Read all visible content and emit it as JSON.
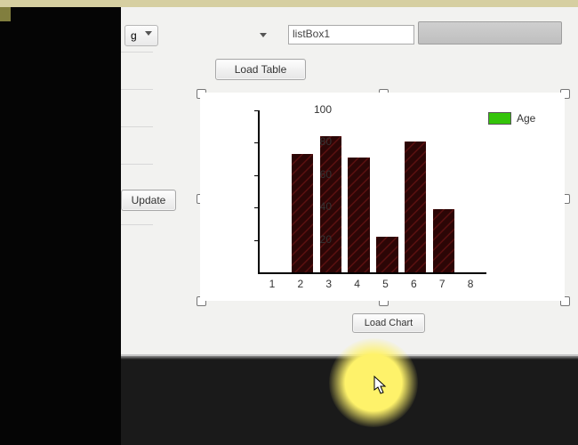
{
  "top": {
    "combo_text": "g",
    "listbox_value": "listBox1"
  },
  "buttons": {
    "load_table": "Load Table",
    "update": "Update",
    "load_chart": "Load Chart"
  },
  "legend": {
    "label": "Age",
    "color": "#34c40a"
  },
  "chart_data": {
    "type": "bar",
    "title": "",
    "xlabel": "",
    "ylabel": "",
    "categories": [
      "1",
      "2",
      "3",
      "4",
      "5",
      "6",
      "7",
      "8"
    ],
    "series": [
      {
        "name": "Age",
        "values": [
          null,
          73,
          84,
          71,
          22,
          81,
          39,
          null
        ]
      }
    ],
    "ylim": [
      0,
      100
    ],
    "yticks": [
      20,
      40,
      60,
      80,
      100
    ],
    "bar_color": "#2c0606"
  }
}
